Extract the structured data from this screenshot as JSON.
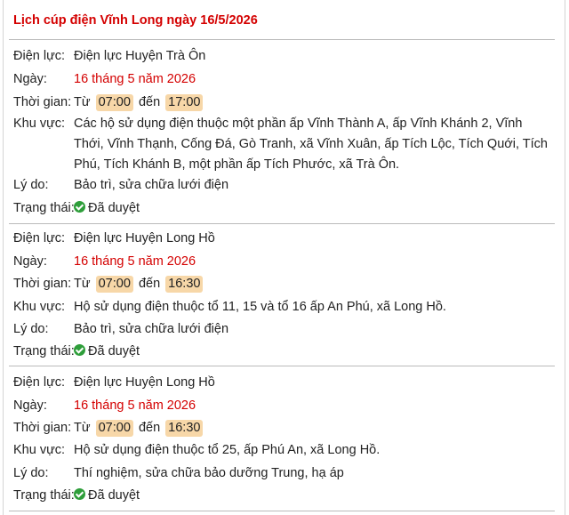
{
  "header": {
    "title": "Lịch cúp điện Vĩnh Long ngày 16/5/2026"
  },
  "labels": {
    "provider": "Điện lực:",
    "date": "Ngày:",
    "time": "Thời gian:",
    "area": "Khu vực:",
    "reason": "Lý do:",
    "status": "Trạng thái:",
    "from": "Từ",
    "to": "đến"
  },
  "outages": [
    {
      "provider": "Điện lực Huyện Trà Ôn",
      "date": "16 tháng 5 năm 2026",
      "start": "07:00",
      "end": "17:00",
      "area": "Các hộ sử dụng điện thuộc một phần ấp Vĩnh Thành A, ấp Vĩnh Khánh 2, Vĩnh Thới, Vĩnh Thạnh, Cống Đá, Gò Tranh, xã Vĩnh Xuân, ấp Tích Lộc, Tích Quới, Tích Phú, Tích Khánh B, một phần ấp Tích Phước, xã Trà Ôn.",
      "reason": "Bảo trì, sửa chữa lưới điện",
      "status": "Đã duyệt"
    },
    {
      "provider": "Điện lực Huyện Long Hồ",
      "date": "16 tháng 5 năm 2026",
      "start": "07:00",
      "end": "16:30",
      "area": "Hộ sử dụng điện thuộc tổ 11, 15 và tổ 16 ấp An Phú, xã Long Hồ.",
      "reason": "Bảo trì, sửa chữa lưới điện",
      "status": "Đã duyệt"
    },
    {
      "provider": "Điện lực Huyện Long Hồ",
      "date": "16 tháng 5 năm 2026",
      "start": "07:00",
      "end": "16:30",
      "area": "Hộ sử dụng điện thuộc tổ 25, ấp Phú An, xã Long Hồ.",
      "reason": "Thí nghiệm, sửa chữa bảo dưỡng Trung, hạ áp",
      "status": "Đã duyệt"
    }
  ],
  "colors": {
    "accent": "#d40000",
    "time_badge": "#f7d7a8",
    "approved": "#2e9e3a"
  },
  "icons": {
    "status": "check-circle-icon"
  }
}
